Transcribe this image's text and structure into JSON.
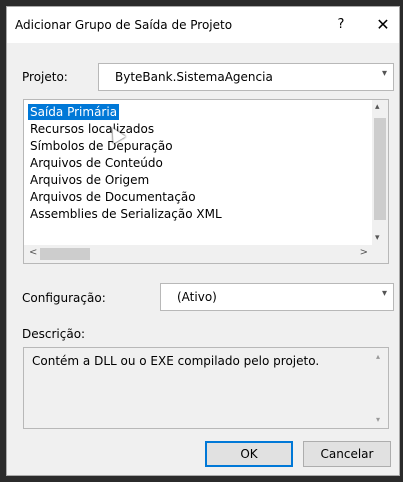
{
  "dialog": {
    "title": "Adicionar Grupo de Saída de Projeto",
    "help_label": "?",
    "close_label": "✕"
  },
  "project": {
    "label": "Projeto:",
    "value": "ByteBank.SistemaAgencia"
  },
  "outputs": {
    "items": [
      "Saída Primária",
      "Recursos localizados",
      "Símbolos de Depuração",
      "Arquivos de Conteúdo",
      "Arquivos de Origem",
      "Arquivos de Documentação",
      "Assemblies de Serialização XML"
    ],
    "selected_index": 0
  },
  "configuration": {
    "label": "Configuração:",
    "value": "(Ativo)"
  },
  "description": {
    "label": "Descrição:",
    "text": "Contém a DLL ou o EXE compilado pelo projeto."
  },
  "buttons": {
    "ok_label": "OK",
    "cancel_label": "Cancelar"
  },
  "icons": {
    "arrow_down": "▾",
    "arrow_up": "▴",
    "arrow_left": "<",
    "arrow_right": ">"
  },
  "colors": {
    "selection": "#0078d7"
  }
}
